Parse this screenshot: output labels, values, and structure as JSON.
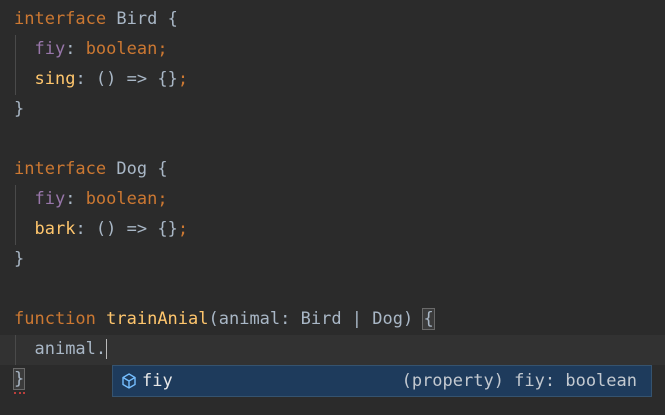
{
  "code": {
    "bird": {
      "kw": "interface",
      "name": "Bird",
      "open": "{",
      "prop1": "fiy",
      "prop1_type": "boolean",
      "prop2": "sing",
      "prop2_sig": "() => {}",
      "close": "}"
    },
    "dog": {
      "kw": "interface",
      "name": "Dog",
      "open": "{",
      "prop1": "fiy",
      "prop1_type": "boolean",
      "prop2": "bark",
      "prop2_sig": "() => {}",
      "close": "}"
    },
    "func": {
      "kw": "function",
      "name": "trainAnial",
      "params": "(animal: Bird | Dog)",
      "open": "{",
      "body": "animal.",
      "close": "}"
    }
  },
  "autocomplete": {
    "icon": "property-cube-icon",
    "label": "fiy",
    "detail": "(property) fiy: boolean"
  },
  "colors": {
    "background": "#2b2b2b",
    "keyword": "#cc7832",
    "property": "#9876aa",
    "method": "#ffc66d",
    "popup_bg": "#1e3b5c"
  }
}
